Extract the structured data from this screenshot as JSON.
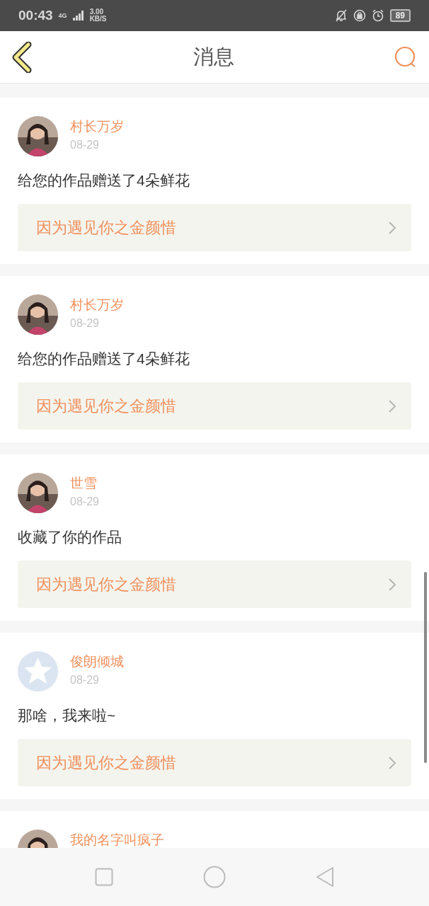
{
  "status_bar": {
    "time": "00:43",
    "network": "4G",
    "speed_value": "3.00",
    "speed_unit": "KB/S",
    "battery": "89"
  },
  "header": {
    "title": "消息"
  },
  "messages": [
    {
      "name": "村长万岁",
      "date": "08-29",
      "text": "给您的作品赠送了4朵鲜花",
      "link": "因为遇见你之金颜惜"
    },
    {
      "name": "村长万岁",
      "date": "08-29",
      "text": "给您的作品赠送了4朵鲜花",
      "link": "因为遇见你之金颜惜"
    },
    {
      "name": "世雪",
      "date": "08-29",
      "text": "收藏了你的作品",
      "link": "因为遇见你之金颜惜"
    },
    {
      "avatar": {
        "kind": "default"
      },
      "name": "俊朗倾城",
      "date": "08-29",
      "text": "那啥，我来啦~",
      "link": "因为遇见你之金颜惜"
    },
    {
      "name": "我的名字叫疯子"
    }
  ]
}
